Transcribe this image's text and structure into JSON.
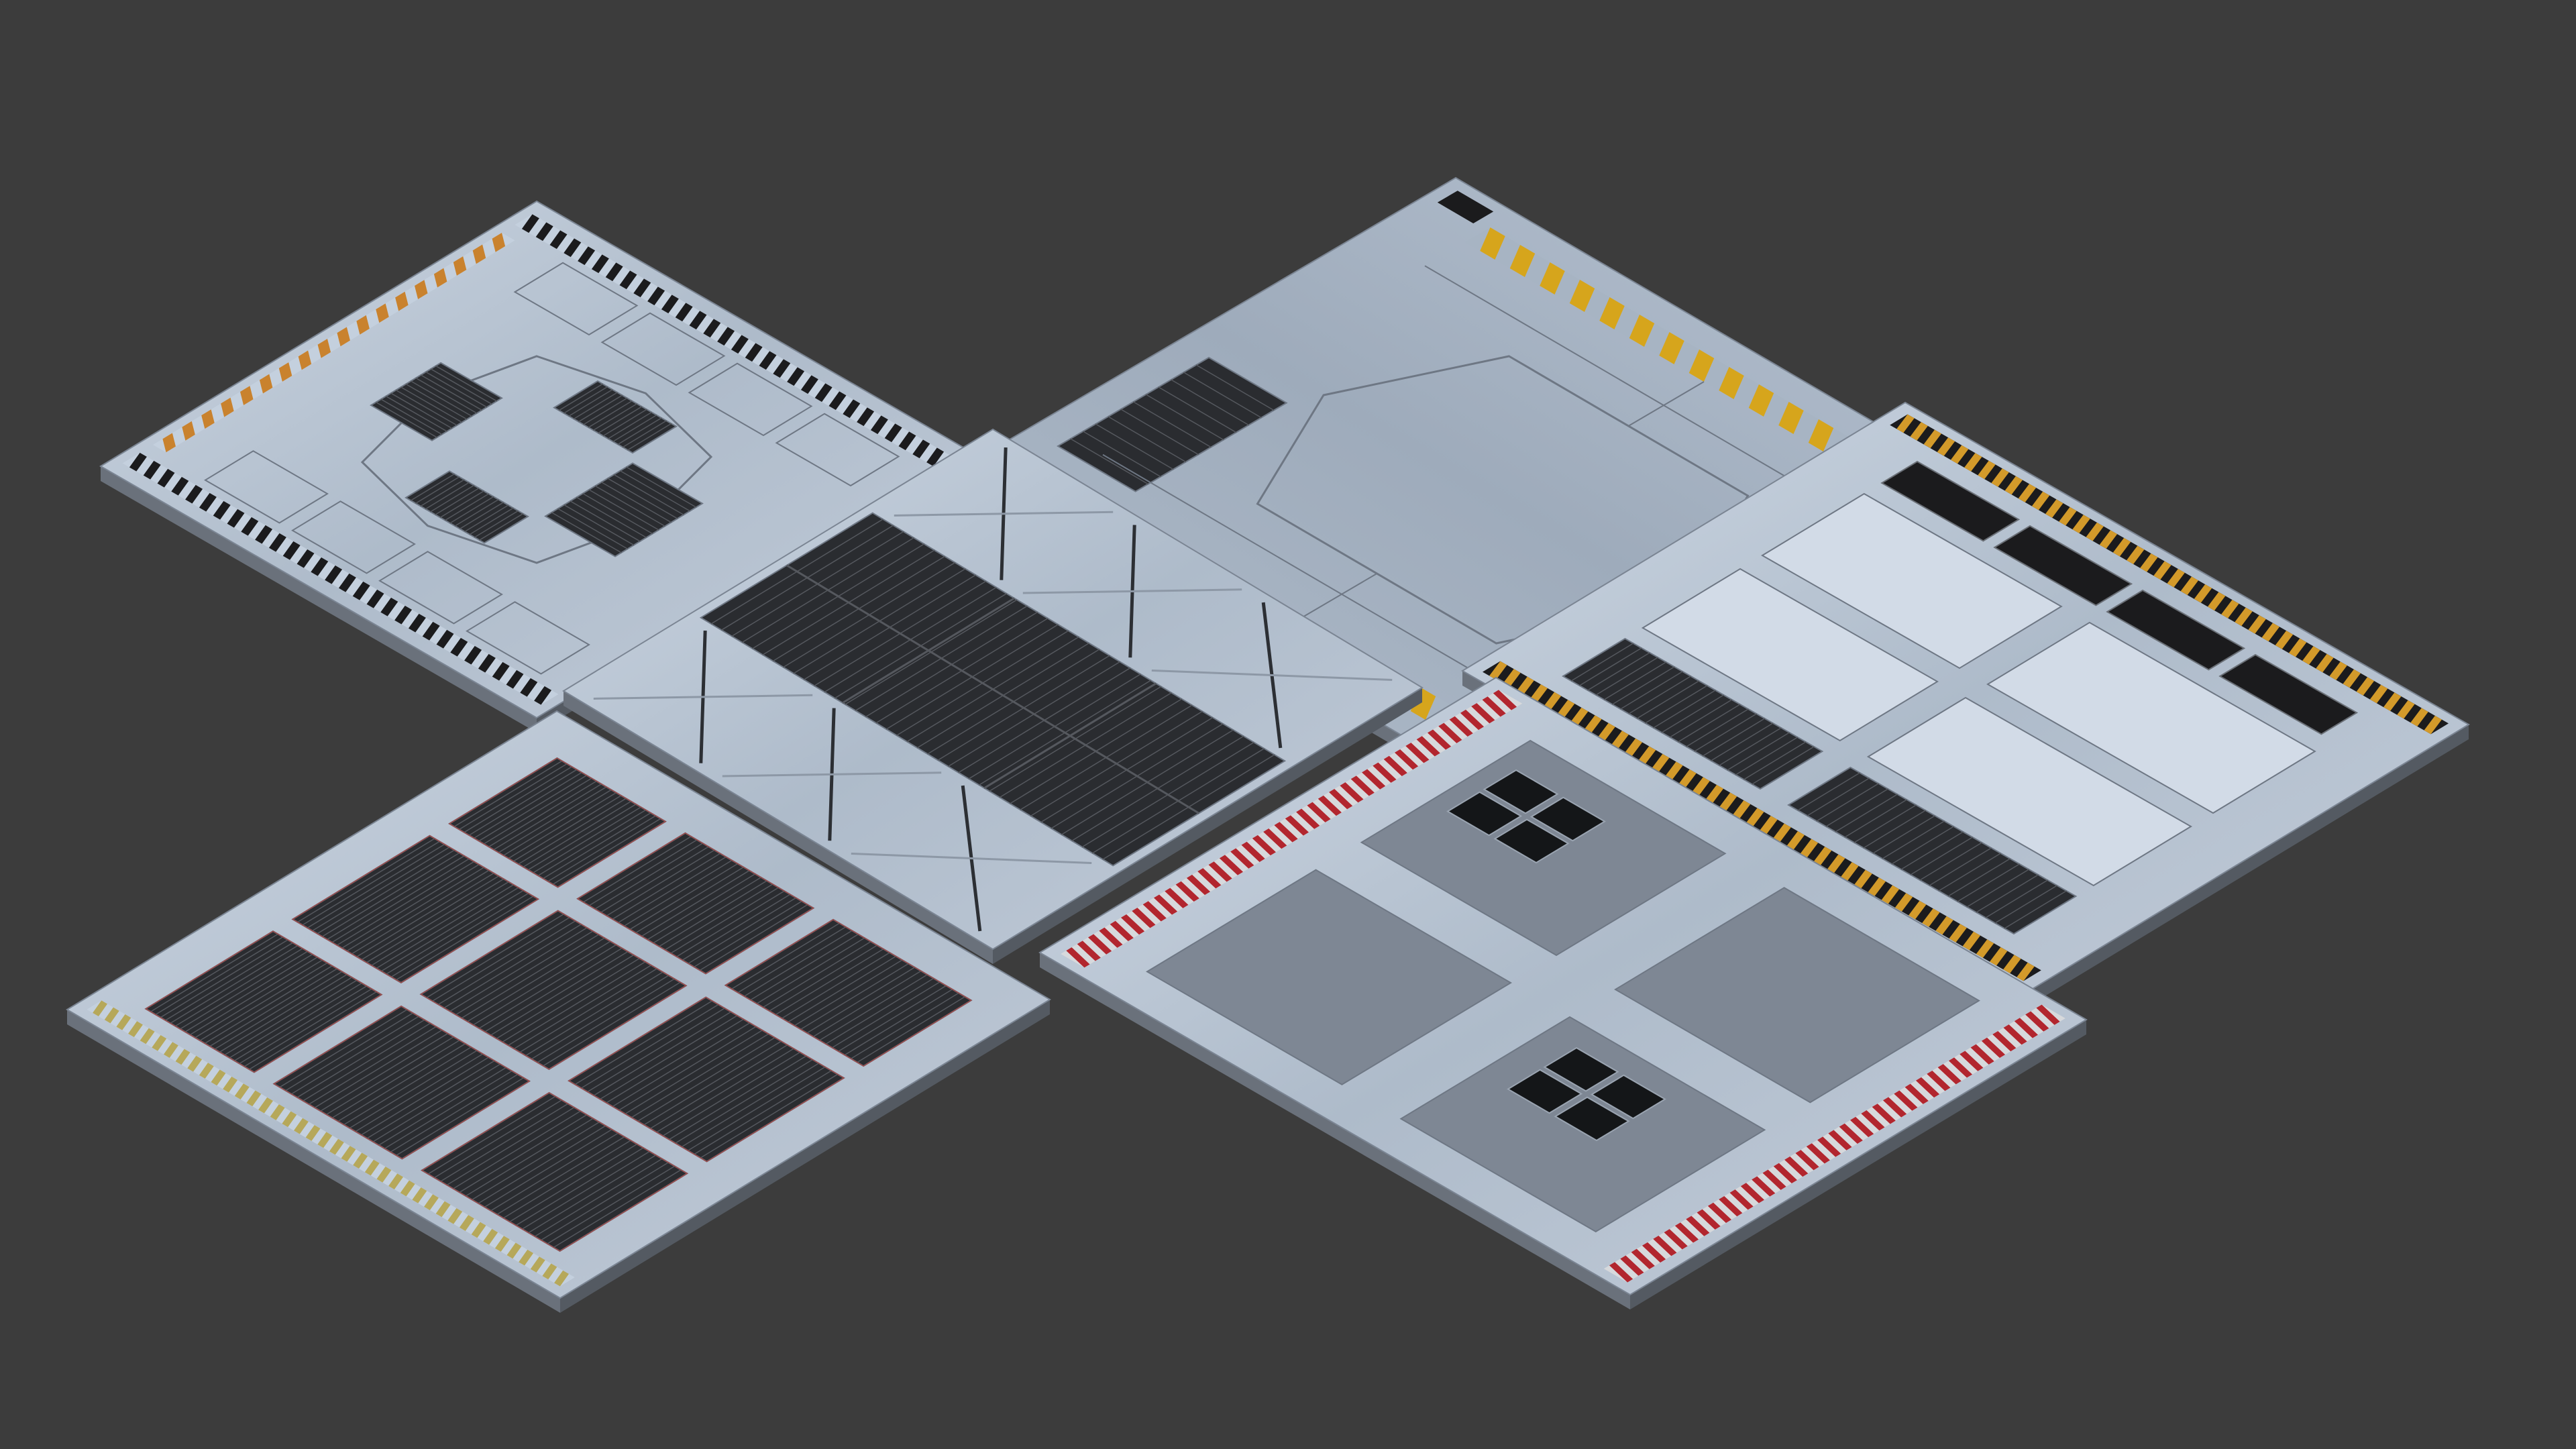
{
  "scene": {
    "background": "#3c3c3c",
    "colors": {
      "metal_light": "#c4d0de",
      "metal_mid": "#a7b4c3",
      "metal_dark": "#8c97a6",
      "seam": "#6e7784",
      "edge_side": "#545a62",
      "grate_dark": "#2a2c30",
      "grate_line": "#55585e",
      "hazard_yellow": "#d6a51c",
      "hazard_black": "#1b1b1d",
      "hazard_red": "#b2262e",
      "hazard_white": "#d7d9dc",
      "grey_inset": "#7e8794",
      "window_dark": "#141618"
    },
    "tiles": [
      {
        "name": "tile-octagon-vents",
        "pattern": "octagon-vents"
      },
      {
        "name": "tile-yellow-hazard",
        "pattern": "yellow-hazard"
      },
      {
        "name": "tile-grate-diagonal-frame",
        "pattern": "center-grate"
      },
      {
        "name": "tile-grid-grates",
        "pattern": "grid-grates"
      },
      {
        "name": "tile-red-hazard-windows",
        "pattern": "red-hazard-windows"
      },
      {
        "name": "tile-light-panels-grates",
        "pattern": "light-panels-grates"
      }
    ]
  }
}
